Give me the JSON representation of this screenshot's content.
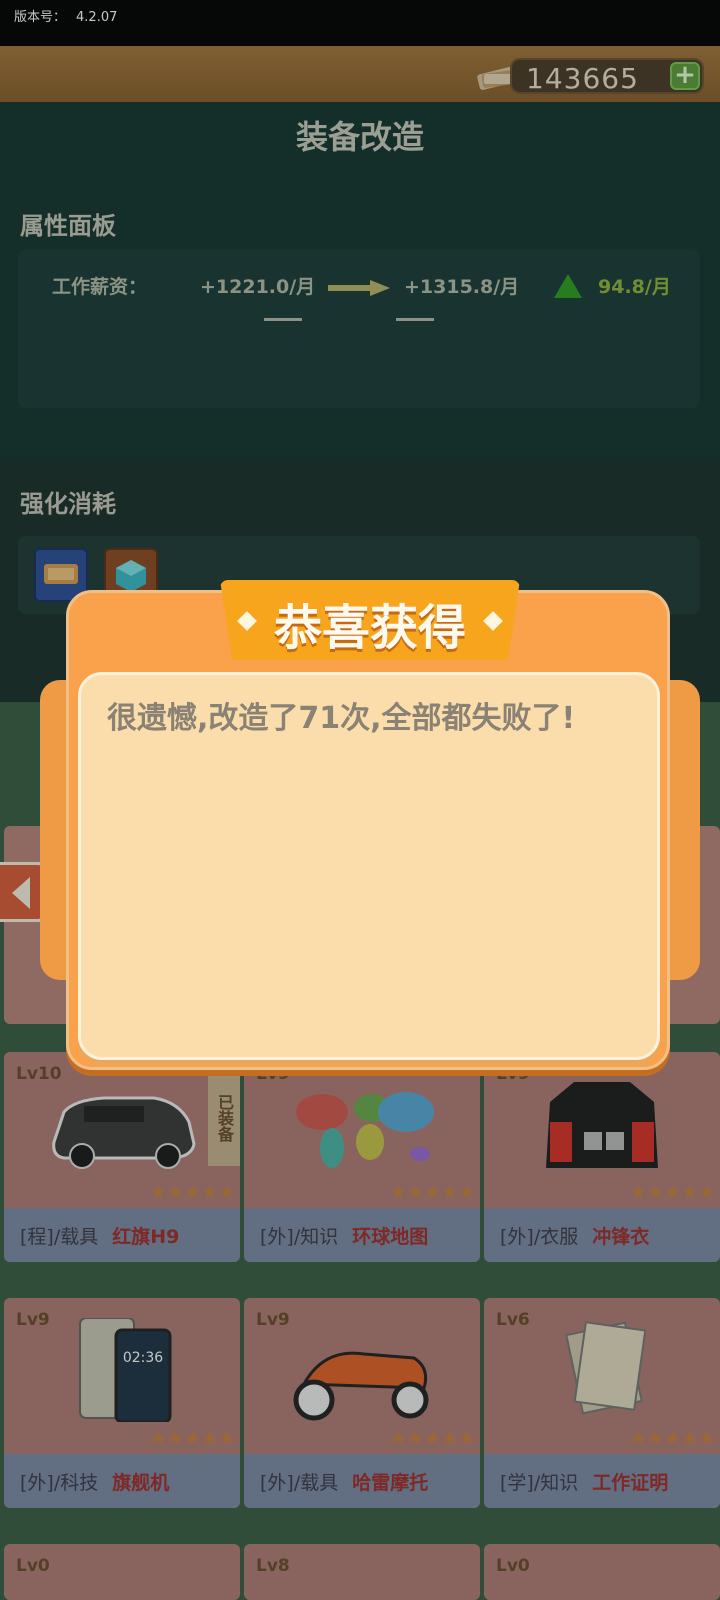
{
  "status": {
    "version_label": "版本号：",
    "version_value": "4.2.07"
  },
  "currency": {
    "value": "143665",
    "plus": "+"
  },
  "page_title": "装备改造",
  "attributes": {
    "title": "属性面板",
    "row": {
      "label": "工作薪资：",
      "current": "+1221.0/月",
      "next": "+1315.8/月",
      "delta": "94.8/月"
    },
    "dash_left": "——",
    "dash_right": "——"
  },
  "cost": {
    "title": "强化消耗"
  },
  "dialog": {
    "title": "恭喜获得",
    "message": "很遗憾,改造了71次,全部都失败了!"
  },
  "cards": [
    {
      "level": "Lv10",
      "equipped": "已装备",
      "stars": "★★★★★",
      "category": "[程]/载具",
      "name": "红旗H9",
      "icon": "car-icon"
    },
    {
      "level": "Lv9",
      "equipped": "",
      "stars": "★★★★★",
      "category": "[外]/知识",
      "name": "环球地图",
      "icon": "world-map-icon"
    },
    {
      "level": "Lv9",
      "equipped": "",
      "stars": "★★★★★",
      "category": "[外]/衣服",
      "name": "冲锋衣",
      "icon": "jacket-icon"
    },
    {
      "level": "Lv9",
      "equipped": "",
      "stars": "★★★★★",
      "category": "[外]/科技",
      "name": "旗舰机",
      "icon": "phone-icon"
    },
    {
      "level": "Lv9",
      "equipped": "",
      "stars": "★★★★★",
      "category": "[外]/载具",
      "name": "哈雷摩托",
      "icon": "motorcycle-icon"
    },
    {
      "level": "Lv6",
      "equipped": "",
      "stars": "★★★★★",
      "category": "[学]/知识",
      "name": "工作证明",
      "icon": "document-icon"
    }
  ],
  "partial_cards": [
    {
      "level": "Lv0"
    },
    {
      "level": "Lv8"
    },
    {
      "level": "Lv0"
    }
  ],
  "colors": {
    "accent_orange": "#f9a14b",
    "panel_dark": "#143330",
    "card_pink": "#b07b77",
    "name_red": "#a32c2c"
  }
}
